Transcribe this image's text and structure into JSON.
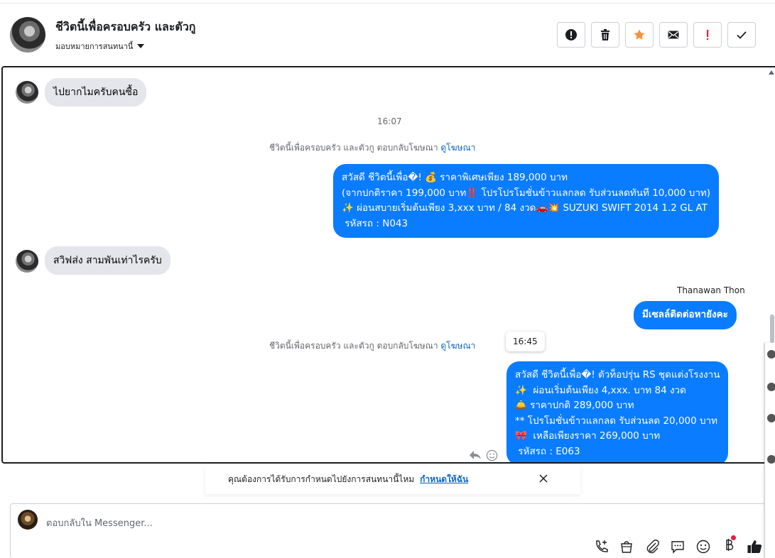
{
  "header": {
    "title": "ชีวิตนี้เพื่อครอบครัว และตัวกู",
    "assign_label": "มอบหมายการสนทนานี้",
    "actions": [
      "alert-icon",
      "trash-icon",
      "star-icon",
      "mail-icon",
      "exclamation-icon",
      "check-icon"
    ],
    "accent_star": "#f7923a",
    "accent_alert": "#e41e3f"
  },
  "messages": {
    "m1": "ไปยากไมครับคนซื้อ",
    "time1": "16:07",
    "sys1_text": "ชีวิตนี้เพื่อครอบครัว และตัวกู ตอบกลับโฆษณา",
    "sys1_link": "ดูโฆษณา",
    "out1": "สวัสดี ชีวิตนี้เพื่อ�! 💰 ราคาพิเศษเพียง 189,000 บาท\n(จากปกติราคา 199,000 บาท‼️ โปรโปรโมชั่นข้าวแลกลด รับส่วนลดทันที 10,000 บาท)\n✨ ผ่อนสบายเริ่มต้นเพียง 3,xxx บาท / 84 งวด🚗💥 SUZUKI SWIFT 2014 1.2 GL AT\n รหัสรถ : N043",
    "m2": "สวิฟส่ง สามพันเท่าไรครับ",
    "sender2": "Thanawan Thon",
    "out2": "มีเซลล์ติดต่อหายังคะ",
    "sys2_text": "ชีวิตนี้เพื่อครอบครัว และตัวกู ตอบกลับโฆษณา",
    "sys2_link": "ดูโฆษณา",
    "tooltip": "16:45",
    "out3": "สวัสดี ชีวิตนี้เพื่อ�! ตัวท็อปรุ่น RS ชุดแต่งโรงงาน\n✨  ผ่อนเริ่มต้นเพียง 4,xxx. บาท 84 งวด\n🛎️ ราคาปกติ 289,000 บาท\n** โปรโมชั่นข้าวแลกลด รับส่วนลด 20,000 บาท\n🎀  เหลือเพียงราคา 269,000 บาท\n รหัสรถ : E063",
    "bubble_color": "#0a7cff"
  },
  "notice": {
    "text": "คุณต้องการได้รับการกำหนดไปยังการสนทนานี้ไหม",
    "link": "กำหนดให้ฉัน"
  },
  "composer": {
    "placeholder": "ตอบกลับใน Messenger...",
    "tools": [
      "call-add-icon",
      "shopping-bag-icon",
      "attach-icon",
      "saved-reply-icon",
      "emoji-icon",
      "baht-icon",
      "like-icon"
    ]
  }
}
